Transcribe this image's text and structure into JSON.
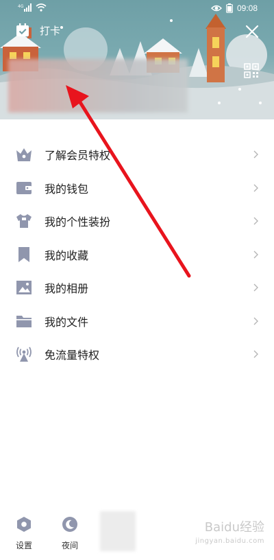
{
  "status_bar": {
    "network_label": "4G",
    "time": "09:08",
    "icons": [
      "signal-icon",
      "wifi-icon",
      "eye-icon",
      "battery-icon"
    ]
  },
  "header": {
    "checkin_label": "打卡",
    "checkin_icon": "calendar-check-icon",
    "close_icon": "close-icon",
    "qr_icon": "qr-code-icon"
  },
  "menu": {
    "items": [
      {
        "label": "了解会员特权",
        "icon": "basket-icon"
      },
      {
        "label": "我的钱包",
        "icon": "wallet-icon"
      },
      {
        "label": "我的个性装扮",
        "icon": "tshirt-icon"
      },
      {
        "label": "我的收藏",
        "icon": "bookmark-icon"
      },
      {
        "label": "我的相册",
        "icon": "image-icon"
      },
      {
        "label": "我的文件",
        "icon": "folder-icon"
      },
      {
        "label": "免流量特权",
        "icon": "broadcast-icon"
      }
    ]
  },
  "bottom": {
    "settings_label": "设置",
    "night_label": "夜间"
  },
  "watermark": {
    "main": "Baidu经验",
    "sub": "jingyan.baidu.com"
  },
  "colors": {
    "icon_gray": "#9096ad",
    "arrow_red": "#e8141d",
    "header_teal": "#7aaab0"
  }
}
